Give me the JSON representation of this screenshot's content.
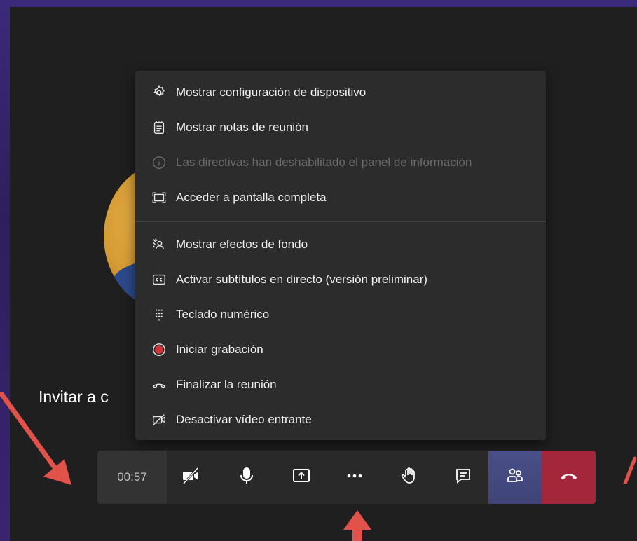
{
  "background_label": "Invitar a c",
  "menu": {
    "items": [
      {
        "label": "Mostrar configuración de dispositivo",
        "icon": "gear-icon",
        "enabled": true
      },
      {
        "label": "Mostrar notas de reunión",
        "icon": "notes-icon",
        "enabled": true
      },
      {
        "label": "Las directivas han deshabilitado el panel de información",
        "icon": "info-icon",
        "enabled": false
      },
      {
        "label": "Acceder a pantalla completa",
        "icon": "fullscreen-icon",
        "enabled": true
      },
      {
        "label": "Mostrar efectos de fondo",
        "icon": "background-effects-icon",
        "enabled": true
      },
      {
        "label": "Activar subtítulos en directo (versión preliminar)",
        "icon": "captions-icon",
        "enabled": true
      },
      {
        "label": "Teclado numérico",
        "icon": "dialpad-icon",
        "enabled": true
      },
      {
        "label": "Iniciar grabación",
        "icon": "record-icon",
        "enabled": true
      },
      {
        "label": "Finalizar la reunión",
        "icon": "end-meeting-icon",
        "enabled": true
      },
      {
        "label": "Desactivar vídeo entrante",
        "icon": "video-off-icon",
        "enabled": true
      }
    ]
  },
  "toolbar": {
    "timer": "00:57",
    "buttons": [
      "camera-off-icon",
      "microphone-icon",
      "share-screen-icon",
      "more-options-icon",
      "raise-hand-icon",
      "chat-icon",
      "participants-icon",
      "hang-up-icon"
    ]
  },
  "colors": {
    "record": "#d13438",
    "hangup": "#a4263a",
    "annotation_arrow": "#e0524a"
  }
}
